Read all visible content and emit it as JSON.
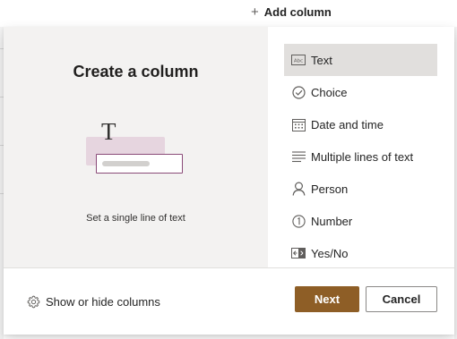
{
  "header": {
    "add_column_label": "Add column",
    "plus_glyph": "+"
  },
  "panel": {
    "title": "Create a column",
    "description": "Set a single line of text",
    "illustration_glyph": "T",
    "column_types": [
      {
        "label": "Text",
        "icon": "text-type-icon",
        "selected": true
      },
      {
        "label": "Choice",
        "icon": "choice-check-icon",
        "selected": false
      },
      {
        "label": "Date and time",
        "icon": "calendar-icon",
        "selected": false
      },
      {
        "label": "Multiple lines of text",
        "icon": "multiline-text-icon",
        "selected": false
      },
      {
        "label": "Person",
        "icon": "person-icon",
        "selected": false
      },
      {
        "label": "Number",
        "icon": "number-icon",
        "selected": false
      },
      {
        "label": "Yes/No",
        "icon": "yes-no-toggle-icon",
        "selected": false
      }
    ]
  },
  "footer": {
    "show_hide_label": "Show or hide columns",
    "show_hide_icon": "gear-icon",
    "next_label": "Next",
    "cancel_label": "Cancel"
  },
  "colors": {
    "primary_button": "#8e5e26",
    "selected_row": "#e1dfdd",
    "left_pane_bg": "#f3f2f1",
    "illustration_accent": "#8a4b78"
  }
}
